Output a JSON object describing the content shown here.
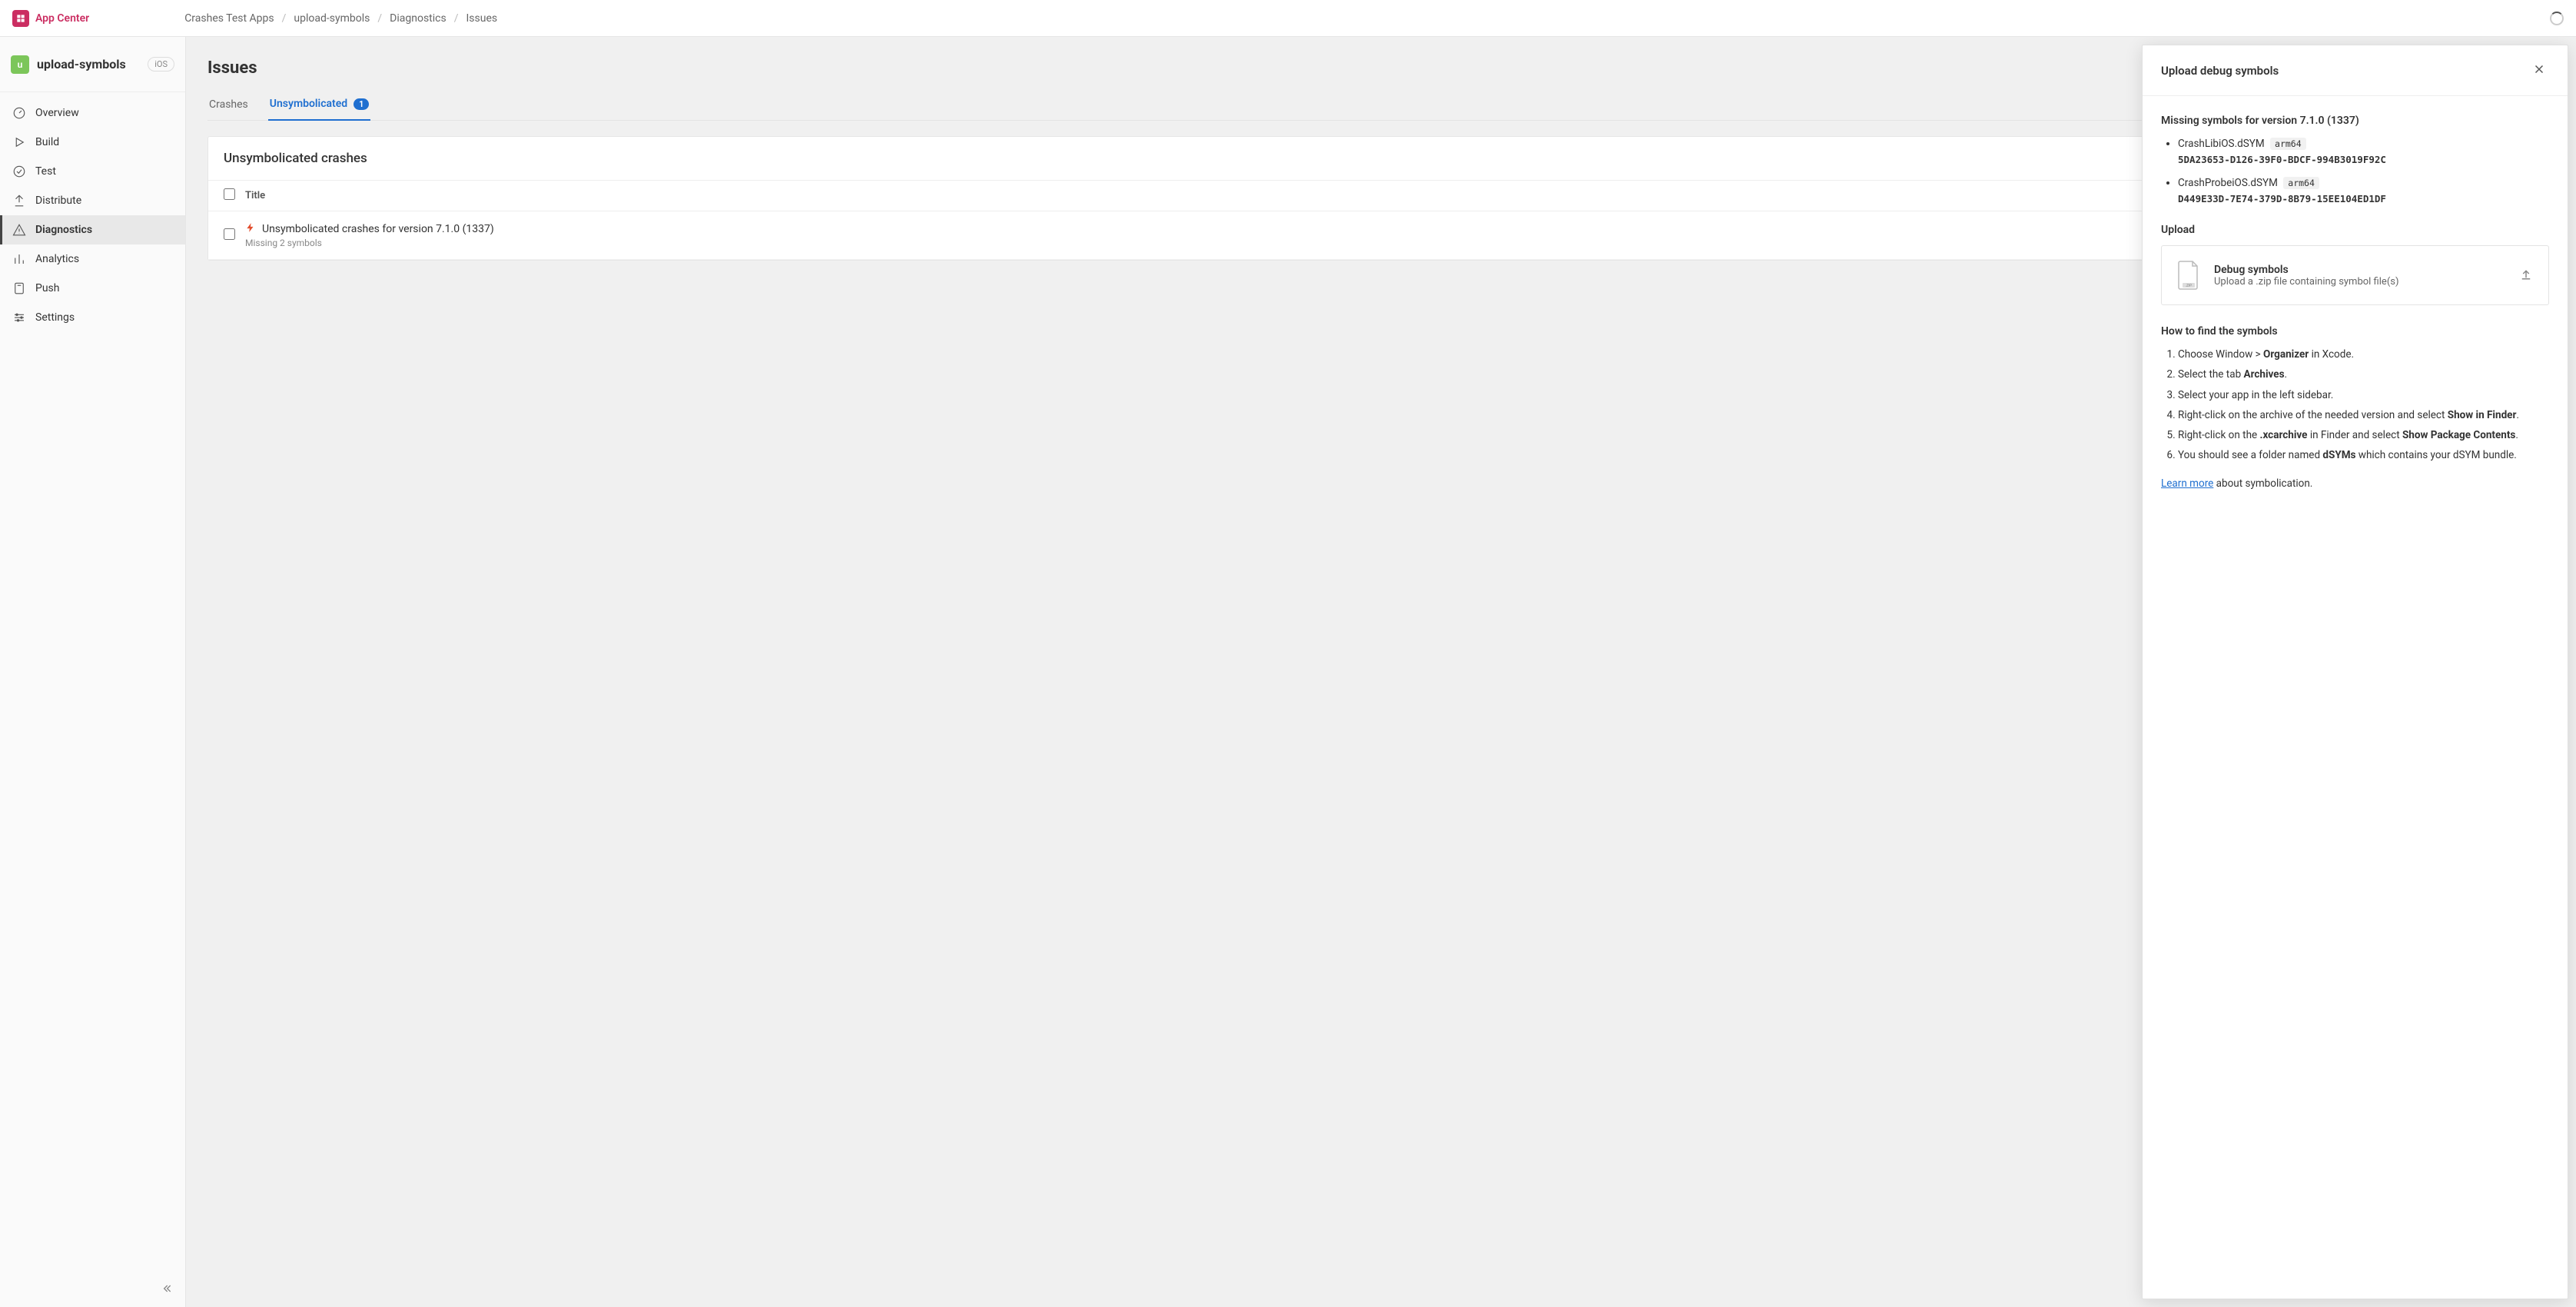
{
  "brand": "App Center",
  "breadcrumbs": [
    "Crashes Test Apps",
    "upload-symbols",
    "Diagnostics",
    "Issues"
  ],
  "app": {
    "initial": "u",
    "name": "upload-symbols",
    "platform": "iOS"
  },
  "nav": {
    "overview": "Overview",
    "build": "Build",
    "test": "Test",
    "distribute": "Distribute",
    "diagnostics": "Diagnostics",
    "analytics": "Analytics",
    "push": "Push",
    "settings": "Settings"
  },
  "page": {
    "title": "Issues",
    "tabs": {
      "crashes": "Crashes",
      "unsymbolicated": "Unsymbolicated",
      "badge": "1"
    },
    "card_title": "Unsymbolicated crashes",
    "col_title": "Title",
    "rows": [
      {
        "title": "Unsymbolicated crashes for version 7.1.0 (1337)",
        "subtitle": "Missing 2 symbols"
      }
    ]
  },
  "panel": {
    "title": "Upload debug symbols",
    "missing_title": "Missing symbols for version 7.1.0 (1337)",
    "missing": [
      {
        "name": "CrashLibiOS.dSYM",
        "arch": "arm64",
        "uuid": "5DA23653-D126-39F0-BDCF-994B3019F92C"
      },
      {
        "name": "CrashProbeiOS.dSYM",
        "arch": "arm64",
        "uuid": "D449E33D-7E74-379D-8B79-15EE104ED1DF"
      }
    ],
    "upload_heading": "Upload",
    "upload_primary": "Debug symbols",
    "upload_secondary": "Upload a .zip file containing symbol file(s)",
    "howto_title": "How to find the symbols",
    "howto": {
      "s1a": "Choose Window > ",
      "s1b": "Organizer",
      "s1c": " in Xcode.",
      "s2a": "Select the tab ",
      "s2b": "Archives",
      "s2c": ".",
      "s3": "Select your app in the left sidebar.",
      "s4a": "Right-click on the archive of the needed version and select ",
      "s4b": "Show in Finder",
      "s4c": ".",
      "s5a": "Right-click on the ",
      "s5b": ".xcarchive",
      "s5c": " in Finder and select ",
      "s5d": "Show Package Contents",
      "s5e": ".",
      "s6a": "You should see a folder named ",
      "s6b": "dSYMs",
      "s6c": " which contains your dSYM bundle."
    },
    "learn_more": "Learn more",
    "learn_more_suffix": " about symbolication."
  }
}
